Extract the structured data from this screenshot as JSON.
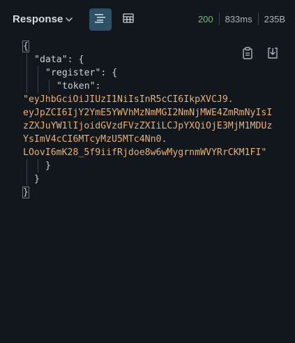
{
  "header": {
    "title": "Response",
    "views": [
      {
        "name": "pretty",
        "active": true
      },
      {
        "name": "table",
        "active": false
      }
    ],
    "status_code": "200",
    "time": "833ms",
    "size": "235B"
  },
  "toolbar": {
    "icons": [
      "copy-icon",
      "download-icon"
    ]
  },
  "code": {
    "open_brace": "{",
    "key_data": "\"data\"",
    "key_register": "\"register\"",
    "key_token": "\"token\"",
    "colon_brace": ": {",
    "colon": ":",
    "token_lines": [
      "\"eyJhbGciOiJIUzI1NiIsInR5cCI6IkpXVCJ9.",
      "eyJpZCI6IjY2YmE5YWVhMzNmMGI2NmNjMWE4ZmRmNyIsI",
      "zZXJuYW1lIjoidGVzdFVzZXIiLCJpYXQiOjE3MjM1MDUz",
      "YsImV4cCI6MTcyMzU5MTc4Nn0.",
      "LOovI6mK28_5f9iifRjdoe8w6wMygrnmWVYRrCKM1FI\""
    ],
    "close_brace": "}"
  },
  "colors": {
    "background": "#11171c",
    "string": "#e8b07a",
    "status_ok": "#69c27b",
    "active_view": "#2f4f67"
  }
}
